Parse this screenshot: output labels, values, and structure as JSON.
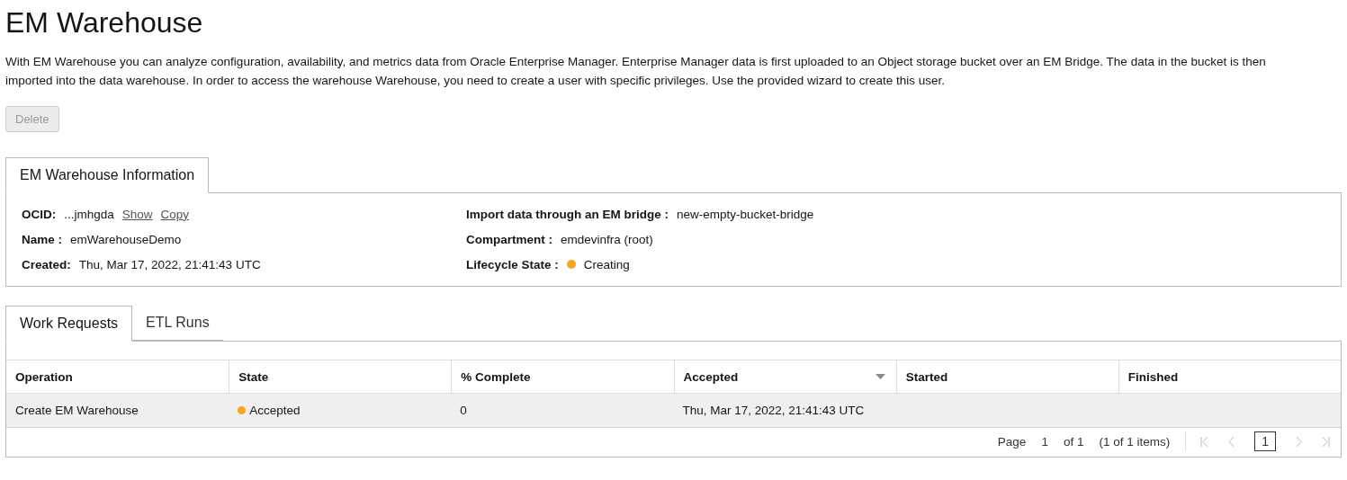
{
  "title": "EM Warehouse",
  "description": "With EM Warehouse you can analyze configuration, availability, and metrics data from Oracle Enterprise Manager. Enterprise Manager data is first uploaded to an Object storage bucket over an EM Bridge. The data in the bucket is then imported into the data warehouse. In order to access the warehouse Warehouse, you need to create a user with specific privileges. Use the provided wizard to create this user.",
  "delete_button": {
    "label": "Delete",
    "disabled": true
  },
  "info_tabs": [
    {
      "label": "EM Warehouse Information",
      "selected": true
    }
  ],
  "info_left": [
    {
      "label": "OCID:",
      "value": "...jmhgda",
      "links": [
        "Show",
        "Copy"
      ]
    },
    {
      "label": "Name :",
      "value": "emWarehouseDemo"
    },
    {
      "label": "Created:",
      "value": "Thu, Mar 17, 2022, 21:41:43 UTC"
    }
  ],
  "info_right": [
    {
      "label": "Import data through an EM bridge :",
      "value": "new-empty-bucket-bridge"
    },
    {
      "label": "Compartment :",
      "value": "emdevinfra (root)"
    },
    {
      "label": "Lifecycle State :",
      "value": "Creating",
      "color": "#f5a623"
    }
  ],
  "tabs": [
    {
      "label": "Work Requests",
      "selected": true
    },
    {
      "label": "ETL Runs",
      "selected": false
    }
  ],
  "table": {
    "columns": [
      {
        "label": "Operation",
        "sorted": false
      },
      {
        "label": "State",
        "sorted": false
      },
      {
        "label": "% Complete",
        "sorted": false
      },
      {
        "label": "Accepted",
        "sorted": true
      },
      {
        "label": "Started",
        "sorted": false
      },
      {
        "label": "Finished",
        "sorted": false
      }
    ],
    "rows": [
      {
        "cells": [
          "Create EM Warehouse",
          "Accepted",
          "0",
          "Thu, Mar 17, 2022, 21:41:43 UTC",
          "",
          ""
        ],
        "color": "#f5a623"
      }
    ]
  },
  "pagination": {
    "page_label": "Page",
    "page": "1",
    "of": "of 1",
    "items": "(1 of 1 items)",
    "current": "1"
  }
}
